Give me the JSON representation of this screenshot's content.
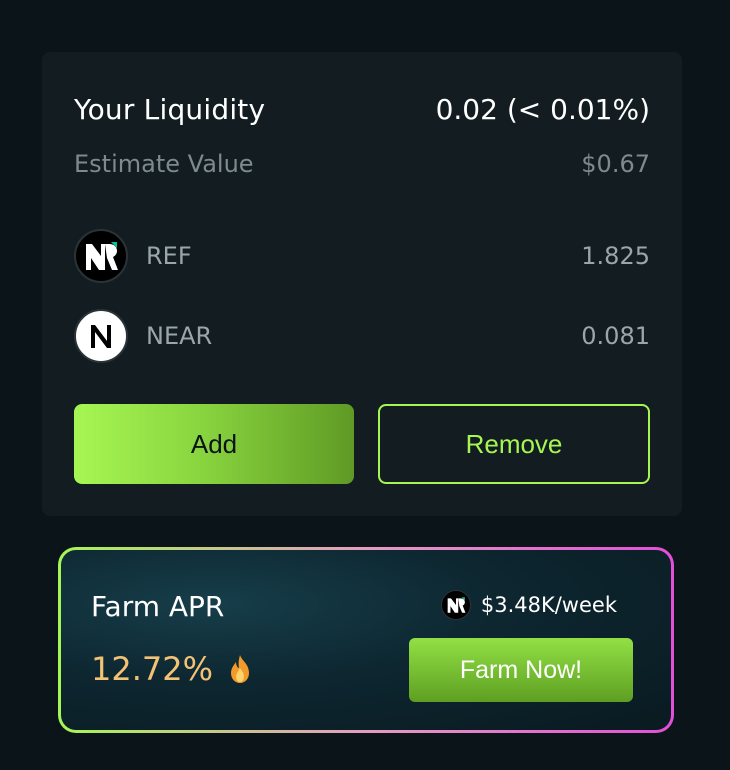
{
  "liquidity": {
    "title": "Your Liquidity",
    "value": "0.02 (< 0.01%)",
    "estimate_label": "Estimate Value",
    "estimate_value": "$0.67",
    "tokens": [
      {
        "symbol": "REF",
        "amount": "1.825",
        "icon": "ref-token-icon"
      },
      {
        "symbol": "NEAR",
        "amount": "0.081",
        "icon": "near-token-icon"
      }
    ],
    "add_label": "Add",
    "remove_label": "Remove"
  },
  "farm": {
    "label": "Farm APR",
    "apr": "12.72%",
    "reward": "$3.48K/week",
    "button_label": "Farm Now!",
    "icons": {
      "fire": "fire-icon",
      "reward": "ref-token-icon"
    }
  },
  "colors": {
    "background": "#0b1418",
    "card": "#121c21",
    "accent_green": "#a6f653",
    "apr_orange": "#f4c275",
    "border_pink": "#e24fd8"
  }
}
